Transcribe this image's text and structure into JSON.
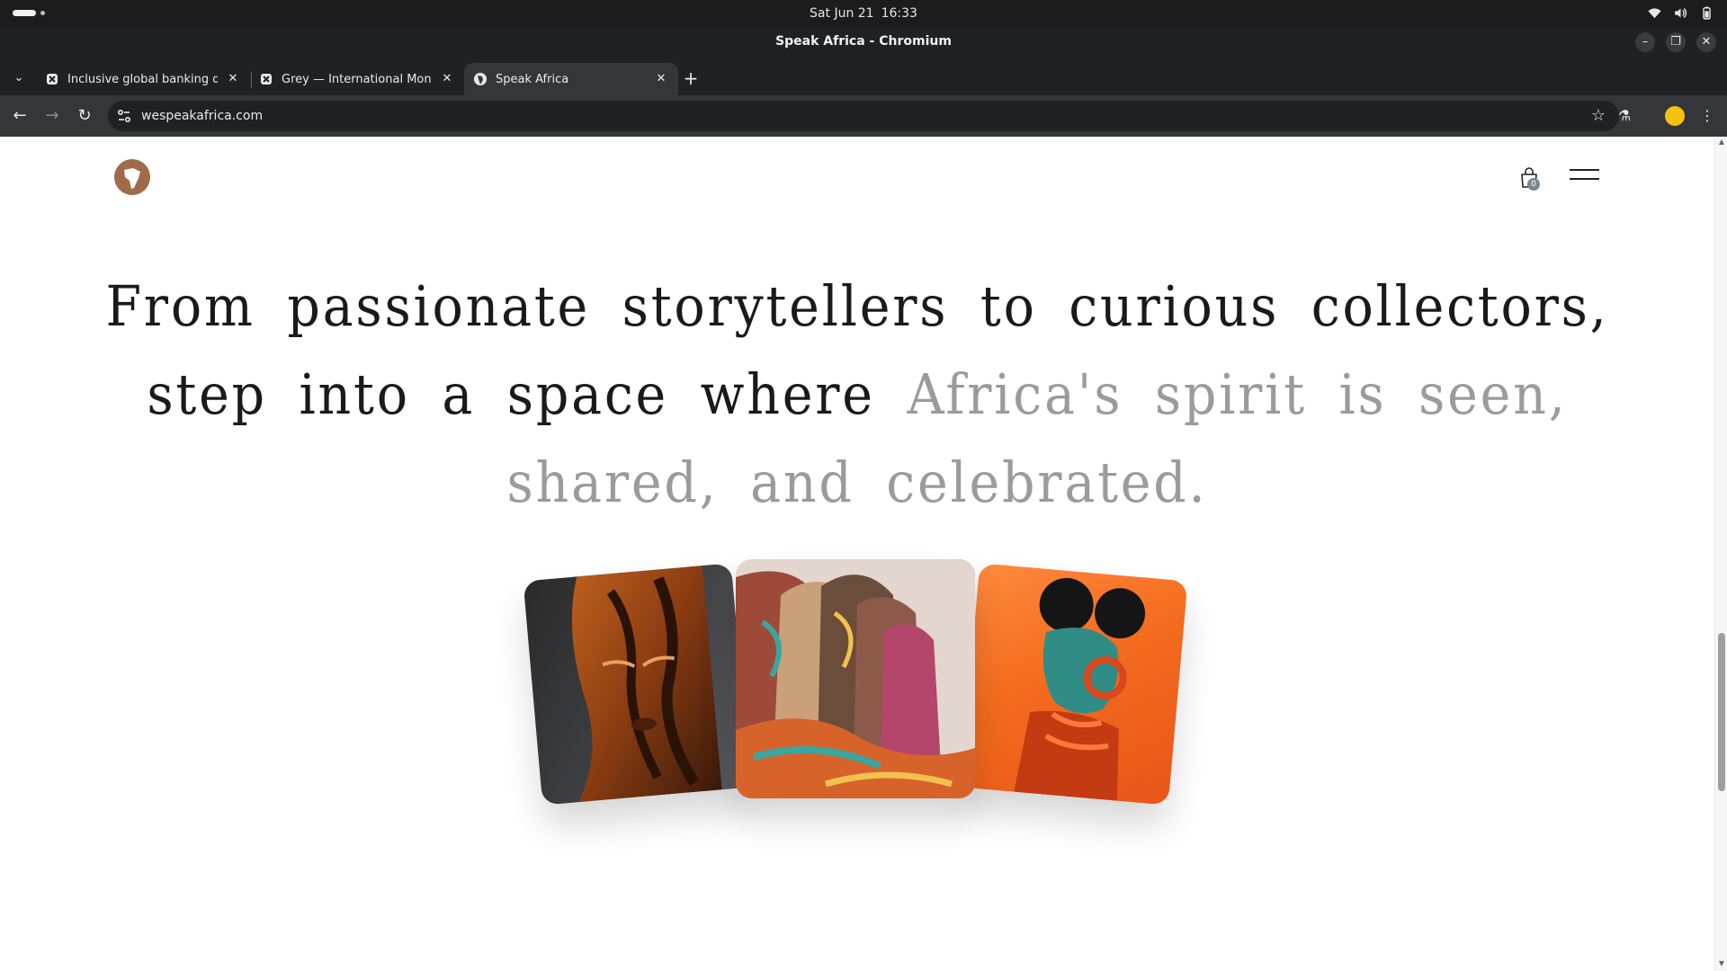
{
  "os": {
    "date": "Sat Jun 21",
    "time": "16:33"
  },
  "window": {
    "title": "Speak Africa - Chromium"
  },
  "tabs": [
    {
      "title": "Inclusive global banking desi",
      "active": false
    },
    {
      "title": "Grey — International Money",
      "active": false
    },
    {
      "title": "Speak Africa",
      "active": true
    }
  ],
  "toolbar": {
    "url": "wespeakafrica.com"
  },
  "site": {
    "brand_color": "#a06b48",
    "cart_count": "0",
    "headline": {
      "line1": "From passionate storytellers to curious collectors,",
      "line2_dark": "step into a space where ",
      "line2_muted": "Africa's spirit is seen,",
      "line3_muted": "shared, and celebrated."
    },
    "gallery": [
      {
        "subject": "carved wooden mask"
      },
      {
        "subject": "row of profiles in patterned headwraps"
      },
      {
        "subject": "portrait with headphones on orange"
      }
    ]
  }
}
